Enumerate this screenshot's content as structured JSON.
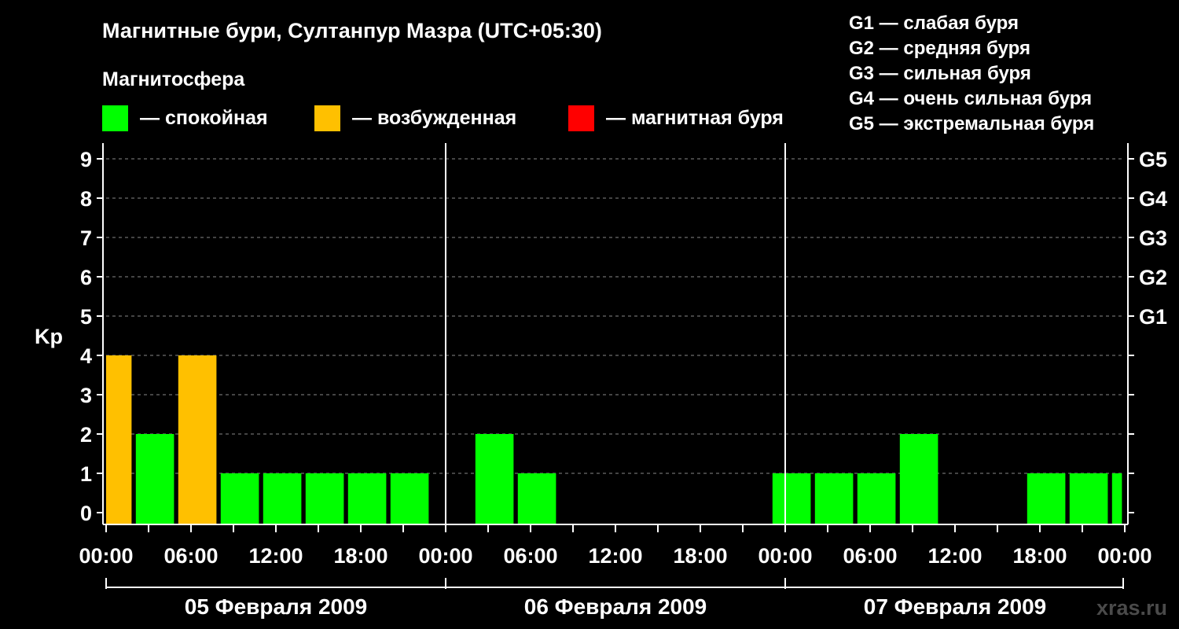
{
  "chart_data": {
    "type": "bar",
    "title": "Магнитные бури, Султанпур Мазра (UTC+05:30)",
    "subtitle": "Магнитосфера",
    "legend": [
      {
        "label": "— спокойная",
        "color": "#00ff00"
      },
      {
        "label": "— возбужденная",
        "color": "#ffc000"
      },
      {
        "label": "— магнитная буря",
        "color": "#ff0000"
      }
    ],
    "g_scale": [
      "G1 — слабая буря",
      "G2 — средняя буря",
      "G3 — сильная буря",
      "G4 — очень сильная буря",
      "G5 — экстремальная буря"
    ],
    "ylabel": "Kp",
    "ylim": [
      0,
      9
    ],
    "y_ticks": [
      "0",
      "1",
      "2",
      "3",
      "4",
      "5",
      "6",
      "7",
      "8",
      "9"
    ],
    "right_ticks": [
      {
        "value": 5,
        "label": "G1"
      },
      {
        "value": 6,
        "label": "G2"
      },
      {
        "value": 7,
        "label": "G3"
      },
      {
        "value": 8,
        "label": "G4"
      },
      {
        "value": 9,
        "label": "G5"
      }
    ],
    "x_hour_range": [
      0,
      72
    ],
    "x_tick_labels": [
      {
        "hour": 0,
        "label": "00:00"
      },
      {
        "hour": 6,
        "label": "06:00"
      },
      {
        "hour": 12,
        "label": "12:00"
      },
      {
        "hour": 18,
        "label": "18:00"
      },
      {
        "hour": 24,
        "label": "00:00"
      },
      {
        "hour": 30,
        "label": "06:00"
      },
      {
        "hour": 36,
        "label": "12:00"
      },
      {
        "hour": 42,
        "label": "18:00"
      },
      {
        "hour": 48,
        "label": "00:00"
      },
      {
        "hour": 54,
        "label": "06:00"
      },
      {
        "hour": 60,
        "label": "12:00"
      },
      {
        "hour": 66,
        "label": "18:00"
      },
      {
        "hour": 72,
        "label": "00:00"
      }
    ],
    "day_labels": [
      {
        "label": "05 Февраля 2009",
        "start": 0,
        "end": 24
      },
      {
        "label": "06 Февраля 2009",
        "start": 24,
        "end": 48
      },
      {
        "label": "07 Февраля 2009",
        "start": 48,
        "end": 72
      }
    ],
    "bars": [
      {
        "start": 0,
        "end": 1.8,
        "kp": 4,
        "state": "excited"
      },
      {
        "start": 2.1,
        "end": 4.8,
        "kp": 2,
        "state": "quiet"
      },
      {
        "start": 5.1,
        "end": 7.8,
        "kp": 4,
        "state": "excited"
      },
      {
        "start": 8.1,
        "end": 10.8,
        "kp": 1,
        "state": "quiet"
      },
      {
        "start": 11.1,
        "end": 13.8,
        "kp": 1,
        "state": "quiet"
      },
      {
        "start": 14.1,
        "end": 16.8,
        "kp": 1,
        "state": "quiet"
      },
      {
        "start": 17.1,
        "end": 19.8,
        "kp": 1,
        "state": "quiet"
      },
      {
        "start": 20.1,
        "end": 22.8,
        "kp": 1,
        "state": "quiet"
      },
      {
        "start": 26.1,
        "end": 28.8,
        "kp": 2,
        "state": "quiet"
      },
      {
        "start": 29.1,
        "end": 31.8,
        "kp": 1,
        "state": "quiet"
      },
      {
        "start": 47.1,
        "end": 49.8,
        "kp": 1,
        "state": "quiet"
      },
      {
        "start": 50.1,
        "end": 52.8,
        "kp": 1,
        "state": "quiet"
      },
      {
        "start": 53.1,
        "end": 55.8,
        "kp": 1,
        "state": "quiet"
      },
      {
        "start": 56.1,
        "end": 58.8,
        "kp": 2,
        "state": "quiet"
      },
      {
        "start": 65.1,
        "end": 67.8,
        "kp": 1,
        "state": "quiet"
      },
      {
        "start": 68.1,
        "end": 70.8,
        "kp": 1,
        "state": "quiet"
      },
      {
        "start": 71.1,
        "end": 71.8,
        "kp": 1,
        "state": "quiet"
      }
    ],
    "state_colors": {
      "quiet": "#00ff00",
      "excited": "#ffc000",
      "storm": "#ff0000"
    },
    "grid": true
  },
  "watermark": "xras.ru"
}
